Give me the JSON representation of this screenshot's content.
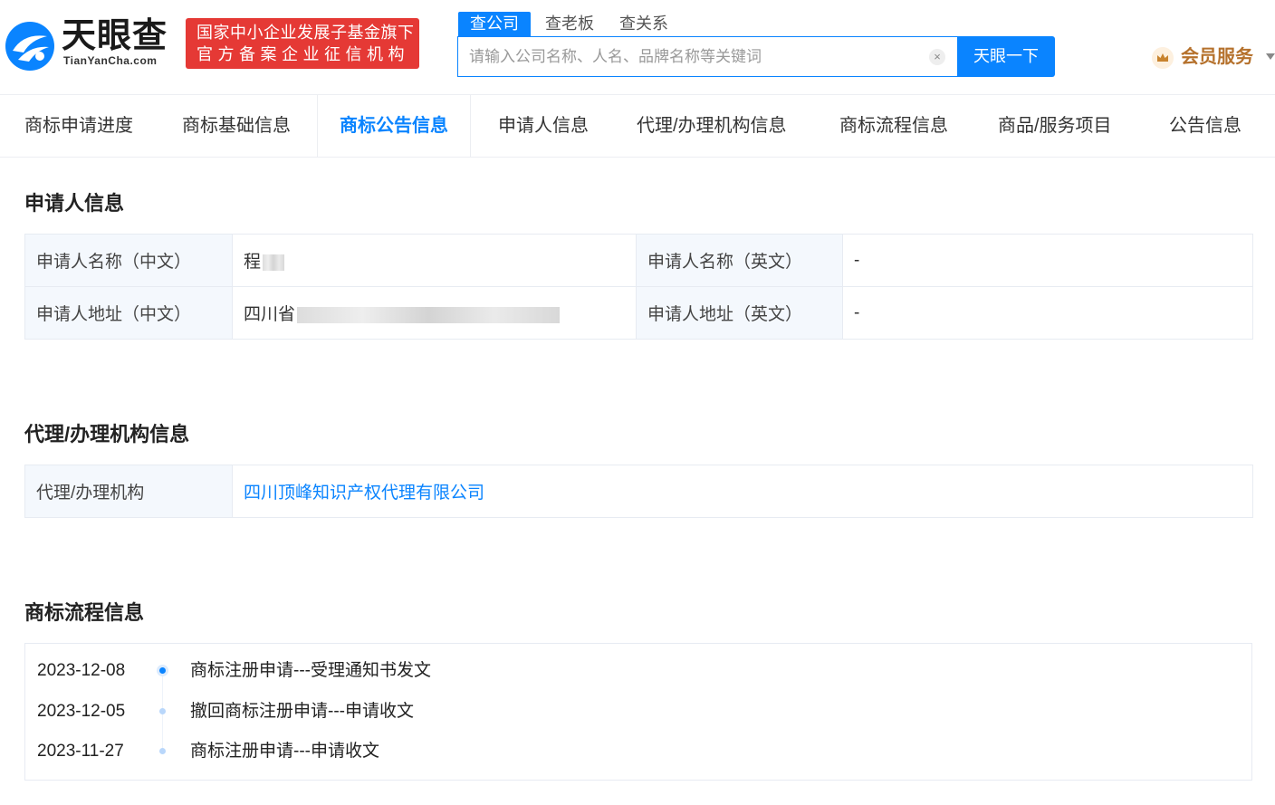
{
  "header": {
    "logo_text": "天眼查",
    "logo_sub": "TianYanCha.com",
    "badge_line1": "国家中小企业发展子基金旗下",
    "badge_line2": "官方备案企业征信机构",
    "search_tabs": [
      "查公司",
      "查老板",
      "查关系"
    ],
    "search_placeholder": "请输入公司名称、人名、品牌名称等关键词",
    "search_button": "天眼一下",
    "clear_symbol": "×",
    "member_label": "会员服务"
  },
  "tabs": [
    "商标申请进度",
    "商标基础信息",
    "商标公告信息",
    "申请人信息",
    "代理/办理机构信息",
    "商标流程信息",
    "商品/服务项目",
    "公告信息"
  ],
  "active_tab": "商标公告信息",
  "applicant": {
    "title": "申请人信息",
    "name_cn_label": "申请人名称（中文）",
    "name_cn_value": "程",
    "name_en_label": "申请人名称（英文）",
    "name_en_value": "-",
    "addr_cn_label": "申请人地址（中文）",
    "addr_cn_value": "四川省",
    "addr_en_label": "申请人地址（英文）",
    "addr_en_value": "-"
  },
  "agency": {
    "title": "代理/办理机构信息",
    "label": "代理/办理机构",
    "value": "四川顶峰知识产权代理有限公司"
  },
  "process": {
    "title": "商标流程信息",
    "items": [
      {
        "date": "2023-12-08",
        "text": "商标注册申请---受理通知书发文"
      },
      {
        "date": "2023-12-05",
        "text": "撤回商标注册申请---申请收文"
      },
      {
        "date": "2023-11-27",
        "text": "商标注册申请---申请收文"
      }
    ]
  },
  "colors": {
    "accent": "#0a84ff",
    "badge": "#e53935",
    "member": "#b5712c"
  }
}
